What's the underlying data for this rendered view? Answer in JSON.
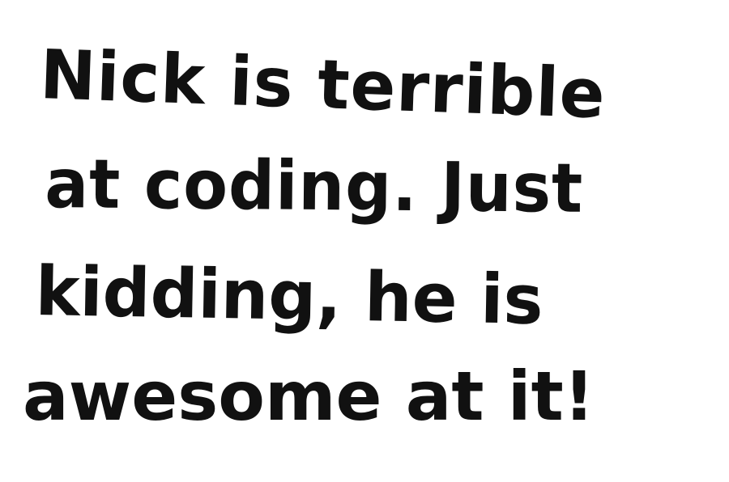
{
  "note": {
    "lines": [
      "Nick is terrible",
      "at coding. Just",
      "kidding, he is",
      "awesome at it!"
    ],
    "ink_color": "#111111",
    "background_color": "#ffffff"
  }
}
